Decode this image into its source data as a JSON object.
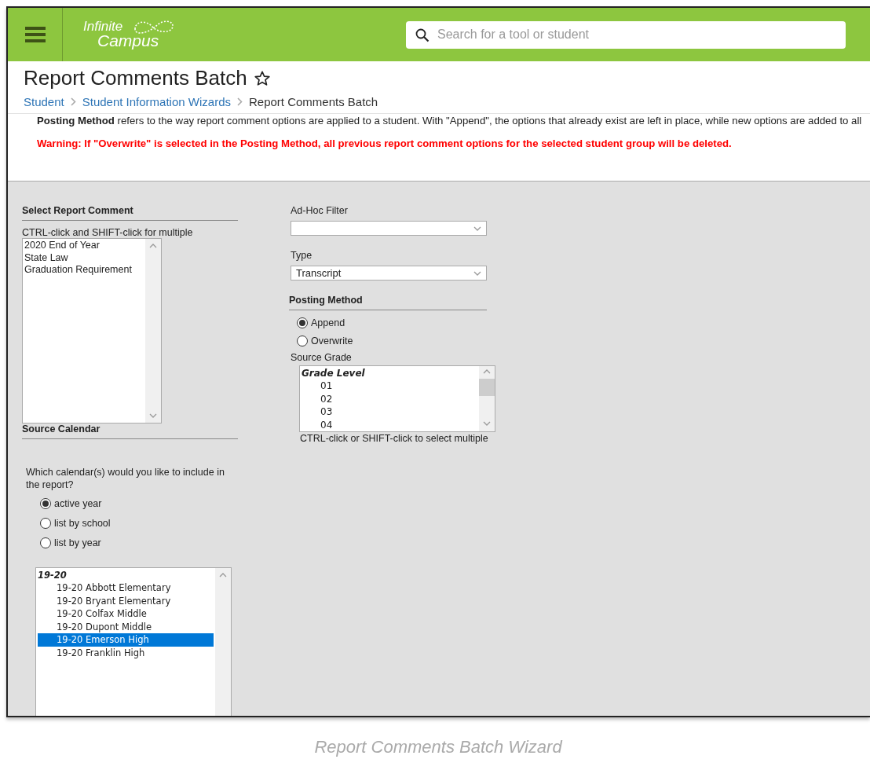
{
  "header": {
    "logo_lines": [
      "Infinite",
      "Campus"
    ],
    "search": {
      "placeholder": "Search for a tool or student"
    }
  },
  "page": {
    "title": "Report Comments Batch",
    "favorite": false
  },
  "breadcrumbs": [
    {
      "label": "Student",
      "kind": "link"
    },
    {
      "label": "Student Information Wizards",
      "kind": "link"
    },
    {
      "label": "Report Comments Batch",
      "kind": "current"
    }
  ],
  "intro": {
    "text": "**Posting Method** refers to the way report comment options are applied to a student. With \"Append\", the options that already exist are left in place, while new options are added to all",
    "warning": "Warning: If \"Overwrite\" is selected in the Posting Method, all previous report comment options for the selected student group will be deleted."
  },
  "report_comment": {
    "heading": "Select Report Comment",
    "hint": "CTRL-click and SHIFT-click for multiple",
    "options": [
      {
        "label": "2020 End of Year",
        "selected": false
      },
      {
        "label": "State Law",
        "selected": false
      },
      {
        "label": "Graduation Requirement",
        "selected": false
      }
    ]
  },
  "source_calendar": {
    "heading": "Source Calendar",
    "question": "Which calendar(s) would you like to include in the report?",
    "choices": [
      {
        "label": "active year",
        "selected": true
      },
      {
        "label": "list by school",
        "selected": false
      },
      {
        "label": "list by year",
        "selected": false
      }
    ],
    "calendars": [
      {
        "label": "19-20",
        "children": [
          {
            "label": "19-20 Abbott Elementary",
            "selected": false
          },
          {
            "label": "19-20 Bryant Elementary",
            "selected": false
          },
          {
            "label": "19-20 Colfax Middle",
            "selected": false
          },
          {
            "label": "19-20 Dupont Middle",
            "selected": false
          },
          {
            "label": "19-20 Emerson High",
            "selected": true
          },
          {
            "label": "19-20 Franklin High",
            "selected": false
          }
        ]
      }
    ]
  },
  "ad_hoc_filter": {
    "label": "Ad-Hoc Filter"
  },
  "type": {
    "label": "Type",
    "value": "Transcript"
  },
  "posting_method": {
    "heading": "Posting Method",
    "choices": [
      {
        "label": "Append",
        "selected": true
      },
      {
        "label": "Overwrite",
        "selected": false
      }
    ]
  },
  "source_grade": {
    "label": "Source Grade",
    "groups": [
      {
        "label": "Grade Level",
        "children": [
          {
            "label": "01",
            "selected": false
          },
          {
            "label": "02",
            "selected": false
          },
          {
            "label": "03",
            "selected": false
          },
          {
            "label": "04",
            "selected": false
          }
        ]
      }
    ],
    "hint": "CTRL-click or SHIFT-click to select multiple"
  },
  "caption": "Report Comments Batch Wizard"
}
